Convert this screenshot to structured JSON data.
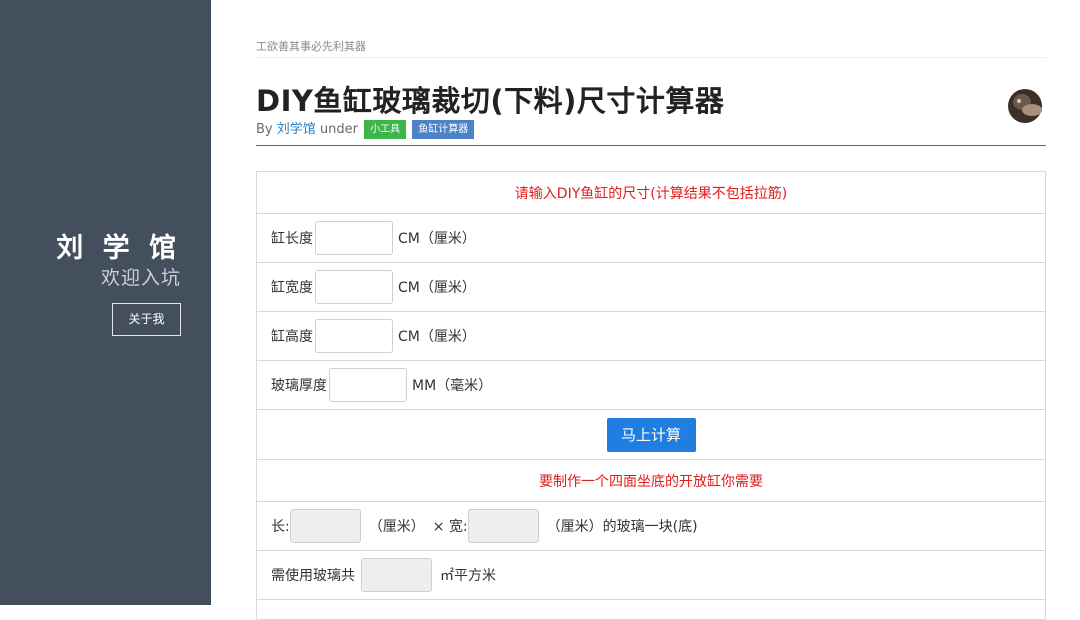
{
  "sidebar": {
    "title": "刘 学 馆",
    "subtitle": "欢迎入坑",
    "about_label": "关于我"
  },
  "header": {
    "motto": "工欲善其事必先利其器",
    "title": "DIY鱼缸玻璃裁切(下料)尺寸计算器",
    "by": "By",
    "author": "刘学馆",
    "under": "under",
    "tags": [
      "小工具",
      "鱼缸计算器"
    ]
  },
  "calculator": {
    "prompt": "请输入DIY鱼缸的尺寸(计算结果不包括拉筋)",
    "fields": [
      {
        "label": "缸长度",
        "unit": "CM（厘米）",
        "value": ""
      },
      {
        "label": "缸宽度",
        "unit": "CM（厘米）",
        "value": ""
      },
      {
        "label": "缸高度",
        "unit": "CM（厘米）",
        "value": ""
      },
      {
        "label": "玻璃厚度",
        "unit": "MM（毫米）",
        "value": ""
      }
    ],
    "button_label": "马上计算",
    "result_heading": "要制作一个四面坐底的开放缸你需要",
    "result_rows": {
      "length_label": "长:",
      "unit1": "（厘米）",
      "times_width": "× 宽:",
      "unit2": "（厘米）的玻璃一块(底)",
      "total_label": "需使用玻璃共",
      "total_unit": "㎡平方米"
    }
  },
  "colors": {
    "sidebar_bg": "#434f5c",
    "accent_blue": "#1f7ee0",
    "tag_green": "#3cb549",
    "tag_blue": "#4b82c8",
    "prompt_red": "#e21b1b"
  }
}
